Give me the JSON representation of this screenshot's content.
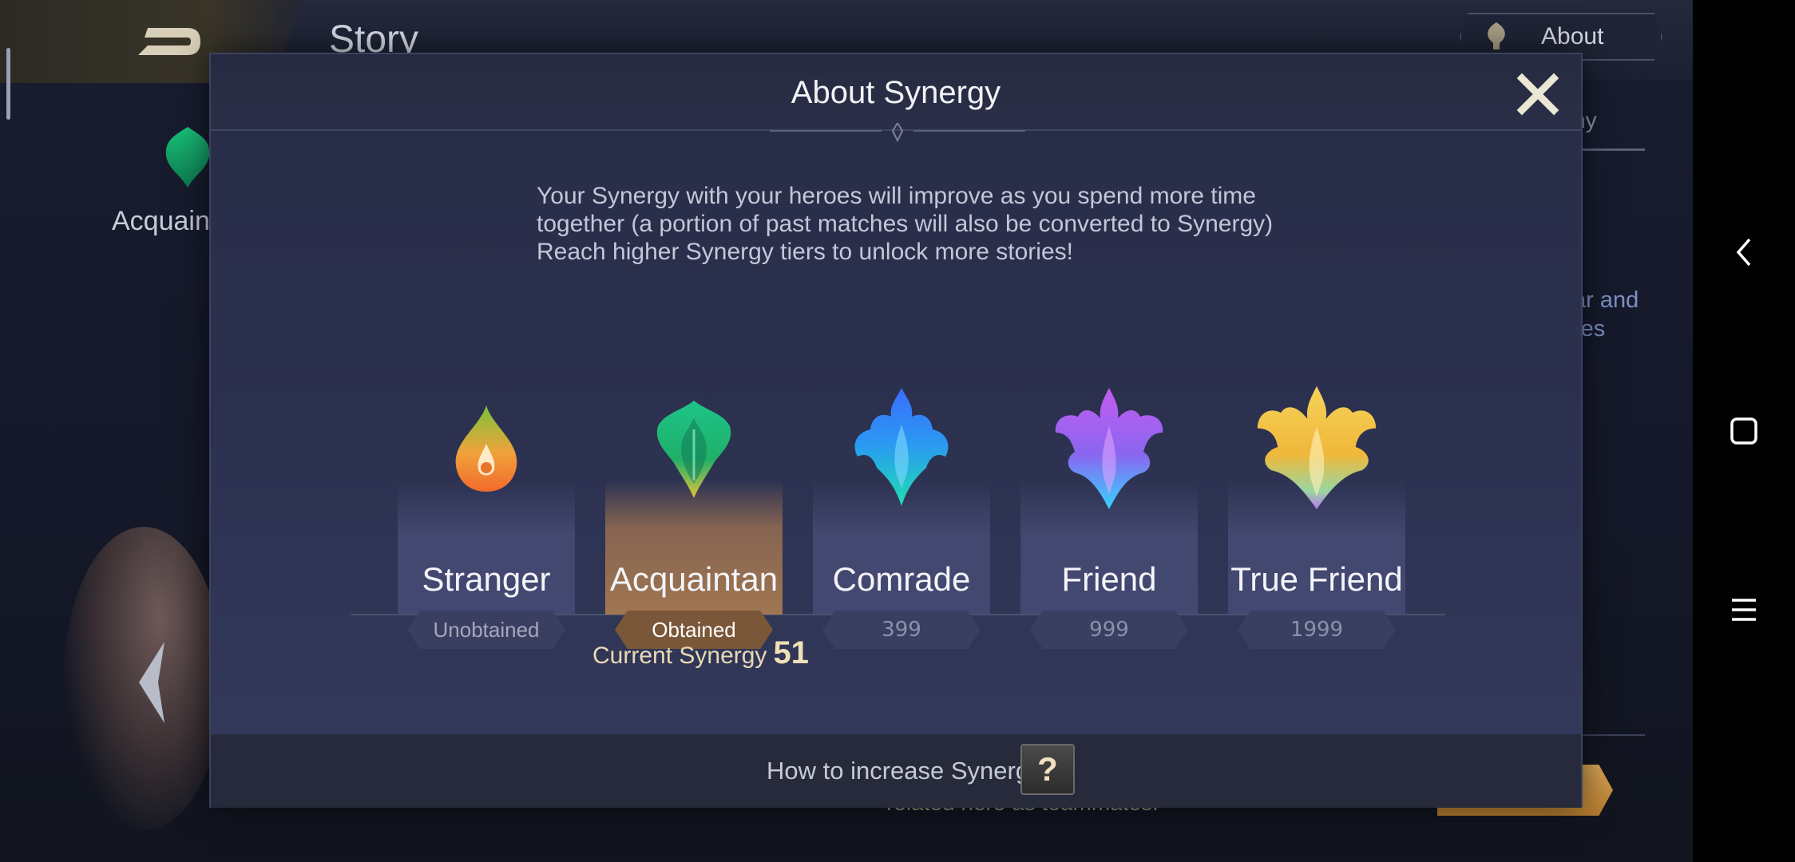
{
  "background": {
    "title": "Story",
    "about_button": "About",
    "left_label": "Acquaint",
    "right_tab": "hy",
    "right_text_line1": "ar and",
    "right_text_line2": "res",
    "bottom_text": "related hero as teammates."
  },
  "modal": {
    "title": "About Synergy",
    "description": "Your Synergy with your heroes will improve as you spend more time together (a portion of past matches will also be converted to Synergy) Reach higher Synergy tiers to unlock more stories!",
    "tiers": [
      {
        "name": "Stranger",
        "status": "Unobtained",
        "icon": "stranger-emblem-icon"
      },
      {
        "name": "Acquaintan",
        "status": "Obtained",
        "icon": "acquaintance-emblem-icon"
      },
      {
        "name": "Comrade",
        "status": "399",
        "icon": "comrade-emblem-icon"
      },
      {
        "name": "Friend",
        "status": "999",
        "icon": "friend-emblem-icon"
      },
      {
        "name": "True Friend",
        "status": "1999",
        "icon": "true-friend-emblem-icon"
      }
    ],
    "current_synergy_label": "Current Synergy",
    "current_synergy_value": "51",
    "footer_link": "How to increase Synergy",
    "help_button": "?"
  },
  "colors": {
    "accent_gold": "#f0e0b6",
    "active_tier": "#a07652"
  }
}
